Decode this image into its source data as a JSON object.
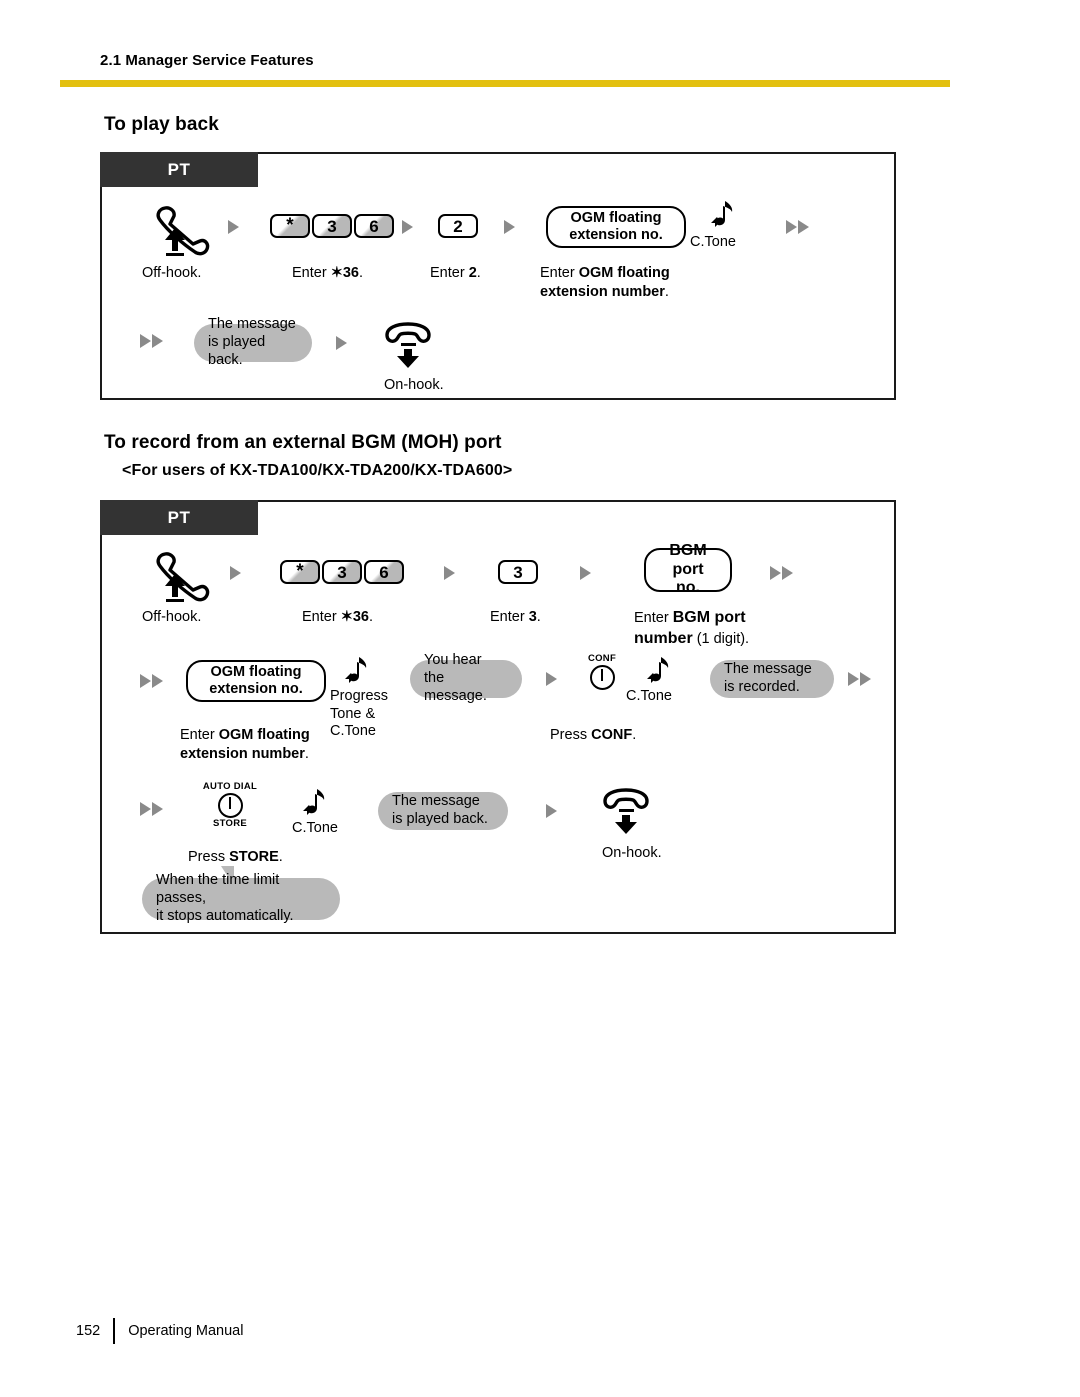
{
  "page": {
    "header": "2.1 Manager Service Features",
    "footer_page_number": "152",
    "footer_label": "Operating Manual",
    "accent_color": "#E3C010",
    "tab_color": "#333333",
    "bubble_color": "#b9b9b9"
  },
  "sections": [
    {
      "title": "To play back",
      "subtitle": "",
      "tab": "PT"
    },
    {
      "title": "To record from an external BGM (MOH) port",
      "subtitle": "<For users of KX-TDA100/KX-TDA200/KX-TDA600>",
      "tab": "PT"
    }
  ],
  "diagram1": {
    "tab": "PT",
    "offhook_caption": "Off-hook.",
    "keys_36": [
      "*",
      "3",
      "6"
    ],
    "keys_36_caption_prefix": "Enter ",
    "keys_36_caption_bold": "✶36",
    "keys_36_caption_suffix": ".",
    "key_2": "2",
    "key_2_caption_prefix": "Enter ",
    "key_2_caption_bold": "2",
    "key_2_caption_suffix": ".",
    "ogm_pill_line1": "OGM floating",
    "ogm_pill_line2": "extension no.",
    "ogm_caption_prefix": "Enter ",
    "ogm_caption_bold1": "OGM floating",
    "ogm_caption_bold2": "extension number",
    "ogm_caption_suffix": ".",
    "ctone_label": "C.Tone",
    "bubble_line1": "The message",
    "bubble_line2": "is played back.",
    "onhook_caption": "On-hook."
  },
  "diagram2": {
    "tab": "PT",
    "offhook_caption": "Off-hook.",
    "keys_36": [
      "*",
      "3",
      "6"
    ],
    "keys_36_caption_prefix": "Enter ",
    "keys_36_caption_bold": "✶36",
    "keys_36_caption_suffix": ".",
    "key_3": "3",
    "key_3_caption_prefix": "Enter ",
    "key_3_caption_bold": "3",
    "key_3_caption_suffix": ".",
    "bgm_pill_line1": "BGM port",
    "bgm_pill_line2": "no.",
    "bgm_caption_prefix": "Enter ",
    "bgm_caption_bold1": "BGM port",
    "bgm_caption_bold2": "number",
    "bgm_caption_suffix": " (1 digit).",
    "ogm_pill_line1": "OGM floating",
    "ogm_pill_line2": "extension no.",
    "ogm_caption_prefix": "Enter ",
    "ogm_caption_bold1": "OGM floating",
    "ogm_caption_bold2": "extension number",
    "ogm_caption_suffix": ".",
    "progress_tone_line1": "Progress",
    "progress_tone_line2": "Tone &",
    "progress_tone_line3": "C.Tone",
    "bubble_hear_line1": "You hear",
    "bubble_hear_line2": "the message.",
    "conf_button_top": "CONF",
    "conf_button_bottom": "",
    "conf_ctone_label": "C.Tone",
    "conf_caption_prefix": "Press ",
    "conf_caption_bold": "CONF",
    "conf_caption_suffix": ".",
    "bubble_recorded_line1": "The message",
    "bubble_recorded_line2": "is recorded.",
    "store_button_top": "AUTO DIAL",
    "store_button_bottom": "STORE",
    "store_ctone_label": "C.Tone",
    "store_caption_prefix": "Press ",
    "store_caption_bold": "STORE",
    "store_caption_suffix": ".",
    "bubble_played_line1": "The message",
    "bubble_played_line2": "is played back.",
    "onhook_caption": "On-hook.",
    "callout_line1": "When the time limit passes,",
    "callout_line2": "it stops automatically."
  }
}
